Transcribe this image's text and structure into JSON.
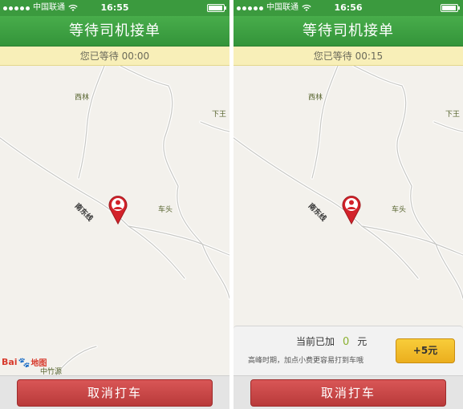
{
  "status_bar": {
    "carrier": "中国联通",
    "left_time": "16:55",
    "right_time": "16:56"
  },
  "nav": {
    "title": "等待司机接单"
  },
  "wait": {
    "left_text": "您已等待 00:00",
    "right_text": "您已等待 00:15"
  },
  "map": {
    "labels": {
      "xilin": "西林",
      "xiawang": "下王",
      "chetou": "车头",
      "nandong": "南东线",
      "zhuyuan": "中竹源"
    },
    "logo": {
      "bai": "Bai",
      "paw": "🐾",
      "ditu": "地图"
    }
  },
  "tip": {
    "prefix": "当前已加",
    "amount": "0",
    "unit": "元",
    "hint": "高峰时期，加点小费更容易打到车哦",
    "add_button": "+5元"
  },
  "actions": {
    "cancel": "取消打车"
  },
  "colors": {
    "green": "#3b9a3e",
    "cancel_red": "#c94747",
    "tip_yellow": "#f3c02f"
  }
}
